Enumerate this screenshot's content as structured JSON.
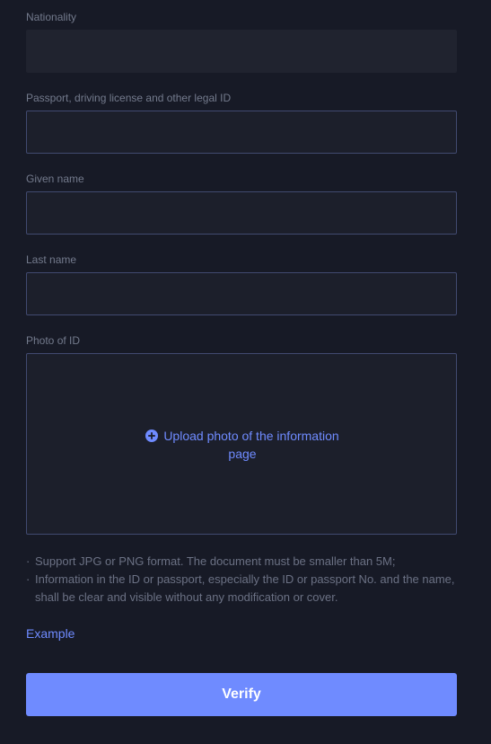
{
  "form": {
    "nationality": {
      "label": "Nationality",
      "value": "",
      "placeholder": ""
    },
    "legal_id": {
      "label": "Passport, driving license and other legal ID",
      "value": "",
      "placeholder": ""
    },
    "given_name": {
      "label": "Given name",
      "value": "",
      "placeholder": ""
    },
    "last_name": {
      "label": "Last name",
      "value": "",
      "placeholder": ""
    },
    "photo": {
      "label": "Photo of ID",
      "upload_text_line1": "Upload photo of the information",
      "upload_text_line2": "page",
      "icon": "plus-circle-icon"
    }
  },
  "notes": {
    "bullet": "·",
    "items": [
      "Support JPG or PNG format. The document must be smaller than 5M;",
      "Information in the ID or passport, especially the ID or passport No. and the name, shall be clear and visible without any modification or cover."
    ]
  },
  "example_link": "Example",
  "verify_button": "Verify",
  "colors": {
    "background": "#171a26",
    "accent": "#6f8bff",
    "input_border": "#414a70",
    "label": "#737a8c"
  }
}
